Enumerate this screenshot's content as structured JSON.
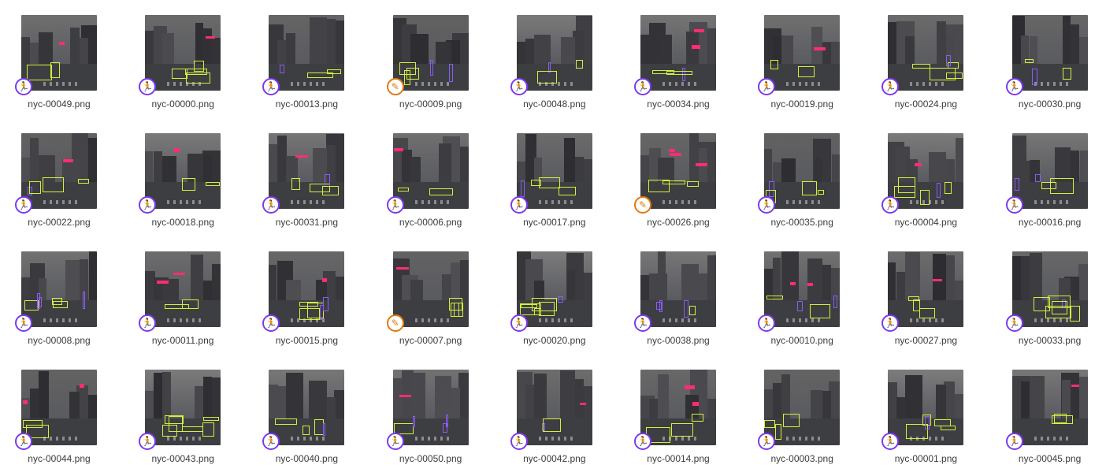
{
  "colors": {
    "box_vehicle": "#d4f03a",
    "box_pedestrian": "#8b5cf6",
    "box_sign": "#ff2d6f",
    "badge_run": "#7c3aed",
    "badge_edit": "#e07a10"
  },
  "icons": {
    "run": {
      "name": "pedestrian-running-icon",
      "glyph": "🏃"
    },
    "edit": {
      "name": "pencil-icon",
      "glyph": "✎"
    }
  },
  "thumbnails": [
    {
      "filename": "nyc-00049.png",
      "badge": "run"
    },
    {
      "filename": "nyc-00000.png",
      "badge": "run"
    },
    {
      "filename": "nyc-00013.png",
      "badge": "run"
    },
    {
      "filename": "nyc-00009.png",
      "badge": "edit"
    },
    {
      "filename": "nyc-00048.png",
      "badge": "run"
    },
    {
      "filename": "nyc-00034.png",
      "badge": "run"
    },
    {
      "filename": "nyc-00019.png",
      "badge": "run"
    },
    {
      "filename": "nyc-00024.png",
      "badge": "run"
    },
    {
      "filename": "nyc-00030.png",
      "badge": "run"
    },
    {
      "filename": "nyc-00022.png",
      "badge": "run"
    },
    {
      "filename": "nyc-00018.png",
      "badge": "run"
    },
    {
      "filename": "nyc-00031.png",
      "badge": "run"
    },
    {
      "filename": "nyc-00006.png",
      "badge": "run"
    },
    {
      "filename": "nyc-00017.png",
      "badge": "run"
    },
    {
      "filename": "nyc-00026.png",
      "badge": "edit"
    },
    {
      "filename": "nyc-00035.png",
      "badge": "run"
    },
    {
      "filename": "nyc-00004.png",
      "badge": "run"
    },
    {
      "filename": "nyc-00016.png",
      "badge": "run"
    },
    {
      "filename": "nyc-00008.png",
      "badge": "run"
    },
    {
      "filename": "nyc-00011.png",
      "badge": "run"
    },
    {
      "filename": "nyc-00015.png",
      "badge": "run"
    },
    {
      "filename": "nyc-00007.png",
      "badge": "edit"
    },
    {
      "filename": "nyc-00020.png",
      "badge": "run"
    },
    {
      "filename": "nyc-00038.png",
      "badge": "run"
    },
    {
      "filename": "nyc-00010.png",
      "badge": "run"
    },
    {
      "filename": "nyc-00027.png",
      "badge": "run"
    },
    {
      "filename": "nyc-00033.png",
      "badge": "run"
    },
    {
      "filename": "nyc-00044.png",
      "badge": "run"
    },
    {
      "filename": "nyc-00043.png",
      "badge": "run"
    },
    {
      "filename": "nyc-00040.png",
      "badge": "run"
    },
    {
      "filename": "nyc-00050.png",
      "badge": "run"
    },
    {
      "filename": "nyc-00042.png",
      "badge": "run"
    },
    {
      "filename": "nyc-00014.png",
      "badge": "run"
    },
    {
      "filename": "nyc-00003.png",
      "badge": "run"
    },
    {
      "filename": "nyc-00001.png",
      "badge": "run"
    },
    {
      "filename": "nyc-00045.png",
      "badge": "run"
    }
  ]
}
